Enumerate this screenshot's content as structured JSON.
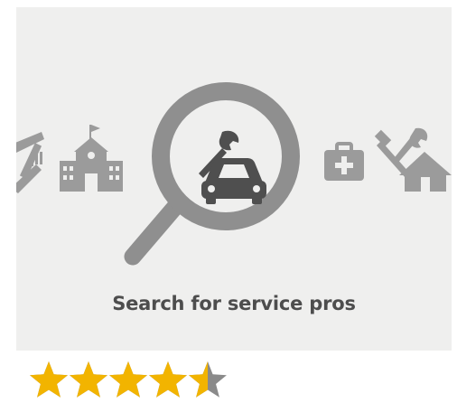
{
  "promo": {
    "caption": "Search for service pros",
    "icons": [
      "tools-icon",
      "school-icon",
      "search-icon",
      "car-repair-icon",
      "medical-kit-icon",
      "home-repair-icon"
    ],
    "colors": {
      "background": "#efefee",
      "icon": "#9b9b9b",
      "magnifier": "#8f8f8f",
      "caption": "#4d4d4d"
    }
  },
  "rating": {
    "value": 4.5,
    "max": 5,
    "star_color": "#f2b400",
    "empty_color": "#8a8a8a"
  }
}
